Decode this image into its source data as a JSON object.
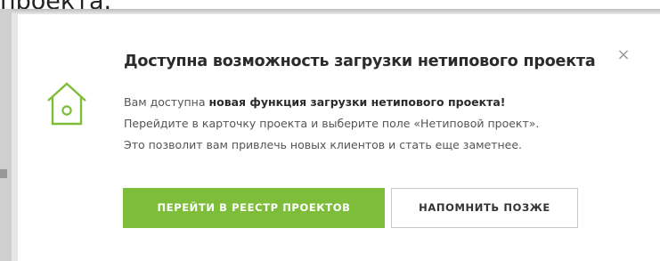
{
  "background": {
    "top_text": "проекта.",
    "bottom_fragment": "…"
  },
  "dialog": {
    "title": "Доступна возможность загрузки нетипового проекта",
    "close_label": "×",
    "body": {
      "line1_prefix": "Вам доступна ",
      "line1_bold": "новая функция загрузки нетипового проекта!",
      "line2": "Перейдите в карточку проекта и выберите поле «Нетиповой проект».",
      "line3": "Это позволит вам привлечь новых клиентов и стать еще заметнее."
    },
    "primary_button": "ПЕРЕЙТИ В РЕЕСТР ПРОЕКТОВ",
    "secondary_button": "НАПОМНИТЬ ПОЗЖЕ",
    "icon": "house-icon",
    "accent_color": "#7dbd3a"
  }
}
